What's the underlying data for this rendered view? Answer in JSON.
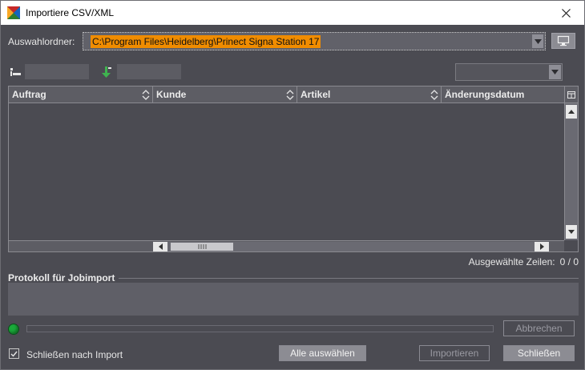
{
  "window": {
    "title": "Importiere CSV/XML",
    "icon": "app-icon",
    "close_icon": "close-icon"
  },
  "folder": {
    "label": "Auswahlordner:",
    "value": "C:\\Program Files\\Heidelberg\\Prinect Signa Station 17",
    "value_highlight": "#f08c00"
  },
  "filters": {
    "field1_value": "",
    "field2_value": "",
    "combo_value": ""
  },
  "table": {
    "columns": [
      "Auftrag",
      "Kunde",
      "Artikel",
      "Änderungsdatum"
    ],
    "rows": []
  },
  "selection": {
    "label": "Ausgewählte Zeilen:",
    "count": "0 / 0"
  },
  "log": {
    "title": "Protokoll für Jobimport",
    "content": ""
  },
  "status": {
    "color": "#1aaa3a",
    "progress": 0
  },
  "buttons": {
    "cancel": "Abbrechen",
    "select_all": "Alle auswählen",
    "import": "Importieren",
    "close": "Schließen"
  },
  "options": {
    "close_after_import_label": "Schließen nach Import",
    "close_after_import_checked": true
  },
  "colors": {
    "background": "#4b4b52",
    "accent": "#f08c00"
  }
}
